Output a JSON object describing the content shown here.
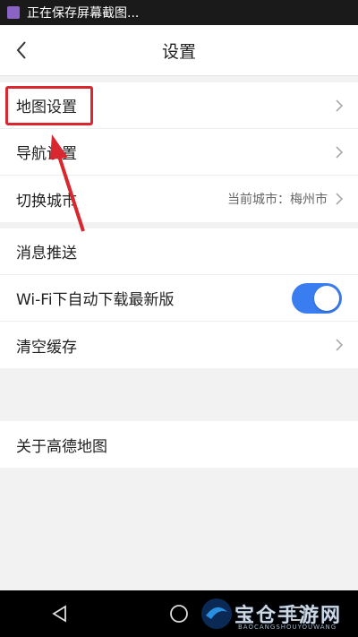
{
  "status_bar": {
    "text": "正在保存屏幕截图..."
  },
  "header": {
    "title": "设置"
  },
  "groups": [
    {
      "items": [
        {
          "label": "地图设置"
        },
        {
          "label": "导航设置"
        },
        {
          "label": "切换城市",
          "value": "当前城市：梅州市"
        }
      ]
    },
    {
      "items": [
        {
          "label": "消息推送"
        },
        {
          "label": "Wi-Fi下自动下载最新版",
          "toggle_on": true
        },
        {
          "label": "清空缓存"
        }
      ]
    },
    {
      "items": [
        {
          "label": "关于高德地图"
        }
      ]
    }
  ],
  "colors": {
    "accent": "#3a7df0",
    "annotation": "#d8272e"
  },
  "icons": {
    "back": "chevron-left-icon",
    "row_arrow": "chevron-right-icon"
  },
  "watermark": {
    "text": "宝仓手游网",
    "subtext": "BAOCANGSHOUYOUWANG"
  }
}
